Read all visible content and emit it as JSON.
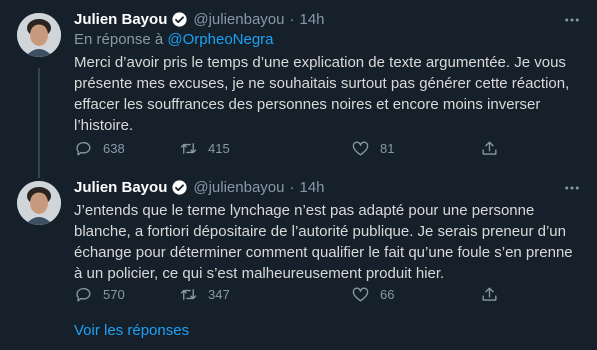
{
  "thread": {
    "tweets": [
      {
        "author_name": "Julien Bayou",
        "handle": "@julienbayou",
        "separator": "·",
        "time": "14h",
        "replying_prefix": "En réponse à",
        "replying_to": "@OrpheoNegra",
        "text": "Merci d’avoir pris le temps d’une explication de texte argumentée. Je vous présente mes excuses, je ne souhaitais surtout pas générer cette réaction, effacer les souffrances des personnes noires et encore moins inverser l’histoire.",
        "replies": "638",
        "retweets": "415",
        "likes": "81"
      },
      {
        "author_name": "Julien Bayou",
        "handle": "@julienbayou",
        "separator": "·",
        "time": "14h",
        "text": "J’entends que le terme lynchage n’est pas adapté pour une personne blanche, a fortiori dépositaire de l’autorité publique. Je serais preneur d’un échange pour déterminer comment qualifier le fait qu’une foule s’en prenne à un policier, ce qui s’est malheureusement produit hier.",
        "replies": "570",
        "retweets": "347",
        "likes": "66"
      }
    ],
    "show_replies_label": "Voir les réponses"
  },
  "colors": {
    "background": "#15202b",
    "text": "#d9d9d9",
    "muted": "#8899a6",
    "accent": "#1da1f2"
  },
  "icons": [
    "verified-badge-icon",
    "more-icon",
    "reply-icon",
    "retweet-icon",
    "like-icon",
    "share-icon"
  ]
}
